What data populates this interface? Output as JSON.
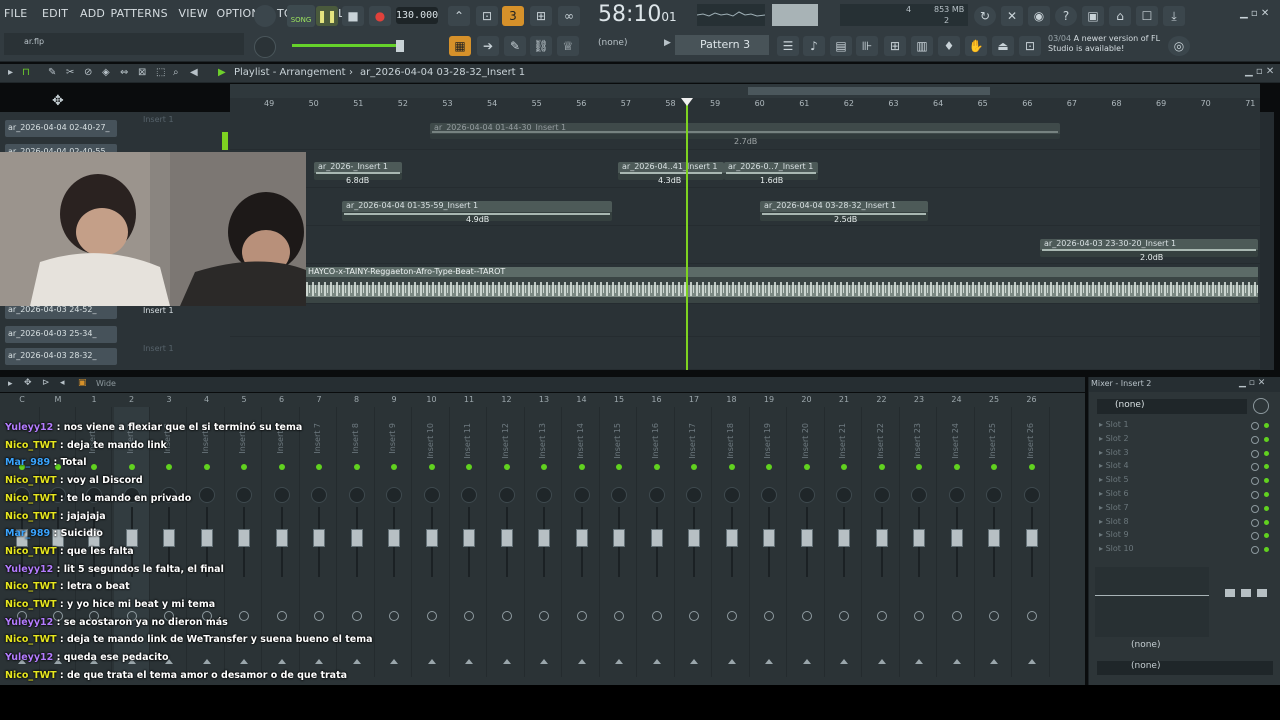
{
  "menu": [
    "FILE",
    "EDIT",
    "ADD",
    "PATTERNS",
    "VIEW",
    "OPTIONS",
    "TOOLS",
    "HELP"
  ],
  "transport": {
    "mode": "SONG",
    "tempo": "130.000",
    "time": "58:10",
    "time_sub": "01",
    "memory": "853 MB",
    "cpu": "4",
    "voices": "2"
  },
  "file": {
    "name": "ar.flp"
  },
  "pattern": {
    "selector": "(none)",
    "name": "Pattern 3"
  },
  "notification": {
    "date": "03/04",
    "text": "A newer version of FL Studio is available!"
  },
  "playlist": {
    "title": "Playlist - Arrangement",
    "arrangement": "ar_2026-04-04 03-28-32_Insert 1"
  },
  "ruler_ticks": [
    "49",
    "50",
    "51",
    "52",
    "53",
    "54",
    "55",
    "56",
    "57",
    "58",
    "59",
    "60",
    "61",
    "62",
    "63",
    "64",
    "65",
    "66",
    "67",
    "68",
    "69",
    "70",
    "71"
  ],
  "sidebar_tracks": [
    "ar_2026-04-04 02-40-27_",
    "ar_2026-04-04 02-40-55",
    "ar_2026-04-03 24-52_",
    "ar_2026-04-03 25-34_",
    "ar_2026-04-03 28-32_"
  ],
  "lane_labels": [
    "Insert 1",
    "Insert 1",
    "Insert 1"
  ],
  "clips": [
    {
      "name": "ar_2026-04-04 01-44-30_Insert 1",
      "db": "2.7dB"
    },
    {
      "name": "ar_2026-_Insert 1",
      "db": "6.8dB"
    },
    {
      "name": "ar_2026-04..41_Insert 1",
      "db": "4.3dB"
    },
    {
      "name": "ar_2026-0..7_Insert 1",
      "db": "1.6dB"
    },
    {
      "name": "ar_2026-04-04 01-35-59_Insert 1",
      "db": "4.9dB"
    },
    {
      "name": "ar_2026-04-04 03-28-32_Insert 1",
      "db": "2.5dB"
    },
    {
      "name": "ar_2026-04-03 23-30-20_Insert 1",
      "db": "2.0dB"
    },
    {
      "name": "HAYCO-x-TAINY-Reggaeton-Afro-Type-Beat--TAROT",
      "db": ""
    }
  ],
  "mixer": {
    "view": "Wide",
    "title": "Mixer - Insert 2",
    "strips": [
      "C",
      "M",
      "1",
      "2",
      "3",
      "4",
      "5",
      "6",
      "7",
      "8",
      "9",
      "10",
      "11",
      "12",
      "13",
      "14",
      "15",
      "16",
      "17",
      "18",
      "19",
      "20",
      "21",
      "22",
      "23",
      "24",
      "25",
      "26"
    ],
    "strip_labels": [
      "",
      "",
      "Insert 1",
      "Insert 2",
      "Insert 3",
      "Insert 4",
      "Insert 5",
      "Insert 6",
      "Insert 7",
      "Insert 8",
      "Insert 9",
      "Insert 10",
      "Insert 11",
      "Insert 12",
      "Insert 13",
      "Insert 14",
      "Insert 15",
      "Insert 16",
      "Insert 17",
      "Insert 18",
      "Insert 19",
      "Insert 20",
      "Insert 21",
      "Insert 22",
      "Insert 23",
      "Insert 24",
      "Insert 25",
      "Insert 26"
    ],
    "insert_input": "(none)",
    "slots": [
      "Slot 1",
      "Slot 2",
      "Slot 3",
      "Slot 4",
      "Slot 5",
      "Slot 6",
      "Slot 7",
      "Slot 8",
      "Slot 9",
      "Slot 10"
    ],
    "eq_in": "(none)",
    "eq_out": "(none)"
  },
  "chat": [
    {
      "user": "Yuleyy12",
      "msg": "nos viene a flexiar que el si terminó su tema",
      "color": "#b47cff"
    },
    {
      "user": "Nico_TWT",
      "msg": "deja te mando link",
      "color": "#e6e61f"
    },
    {
      "user": "Mar_989",
      "msg": "Total",
      "color": "#3ba5ff"
    },
    {
      "user": "Nico_TWT",
      "msg": "voy al Discord",
      "color": "#e6e61f"
    },
    {
      "user": "Nico_TWT",
      "msg": "te lo mando en privado",
      "color": "#e6e61f"
    },
    {
      "user": "Nico_TWT",
      "msg": "jajajaja",
      "color": "#e6e61f"
    },
    {
      "user": "Mar_989",
      "msg": "Suicidio",
      "color": "#3ba5ff"
    },
    {
      "user": "Nico_TWT",
      "msg": "que les falta",
      "color": "#e6e61f"
    },
    {
      "user": "Yuleyy12",
      "msg": "lit 5 segundos le falta, el final",
      "color": "#b47cff"
    },
    {
      "user": "Nico_TWT",
      "msg": "letra o beat",
      "color": "#e6e61f"
    },
    {
      "user": "Nico_TWT",
      "msg": "y yo hice mi beat y mi tema",
      "color": "#e6e61f"
    },
    {
      "user": "Yuleyy12",
      "msg": "se acostaron ya no dieron más",
      "color": "#b47cff"
    },
    {
      "user": "Nico_TWT",
      "msg": "deja te mando link de WeTransfer y suena bueno el tema",
      "color": "#e6e61f"
    },
    {
      "user": "Yuleyy12",
      "msg": "queda ese pedacito",
      "color": "#b47cff"
    },
    {
      "user": "Nico_TWT",
      "msg": "de que trata el tema amor o desamor o de que trata",
      "color": "#e6e61f"
    }
  ],
  "colors": {
    "accent_green": "#61d21f",
    "playhead": "#7ed321",
    "clip_header": "#4d5a58"
  }
}
